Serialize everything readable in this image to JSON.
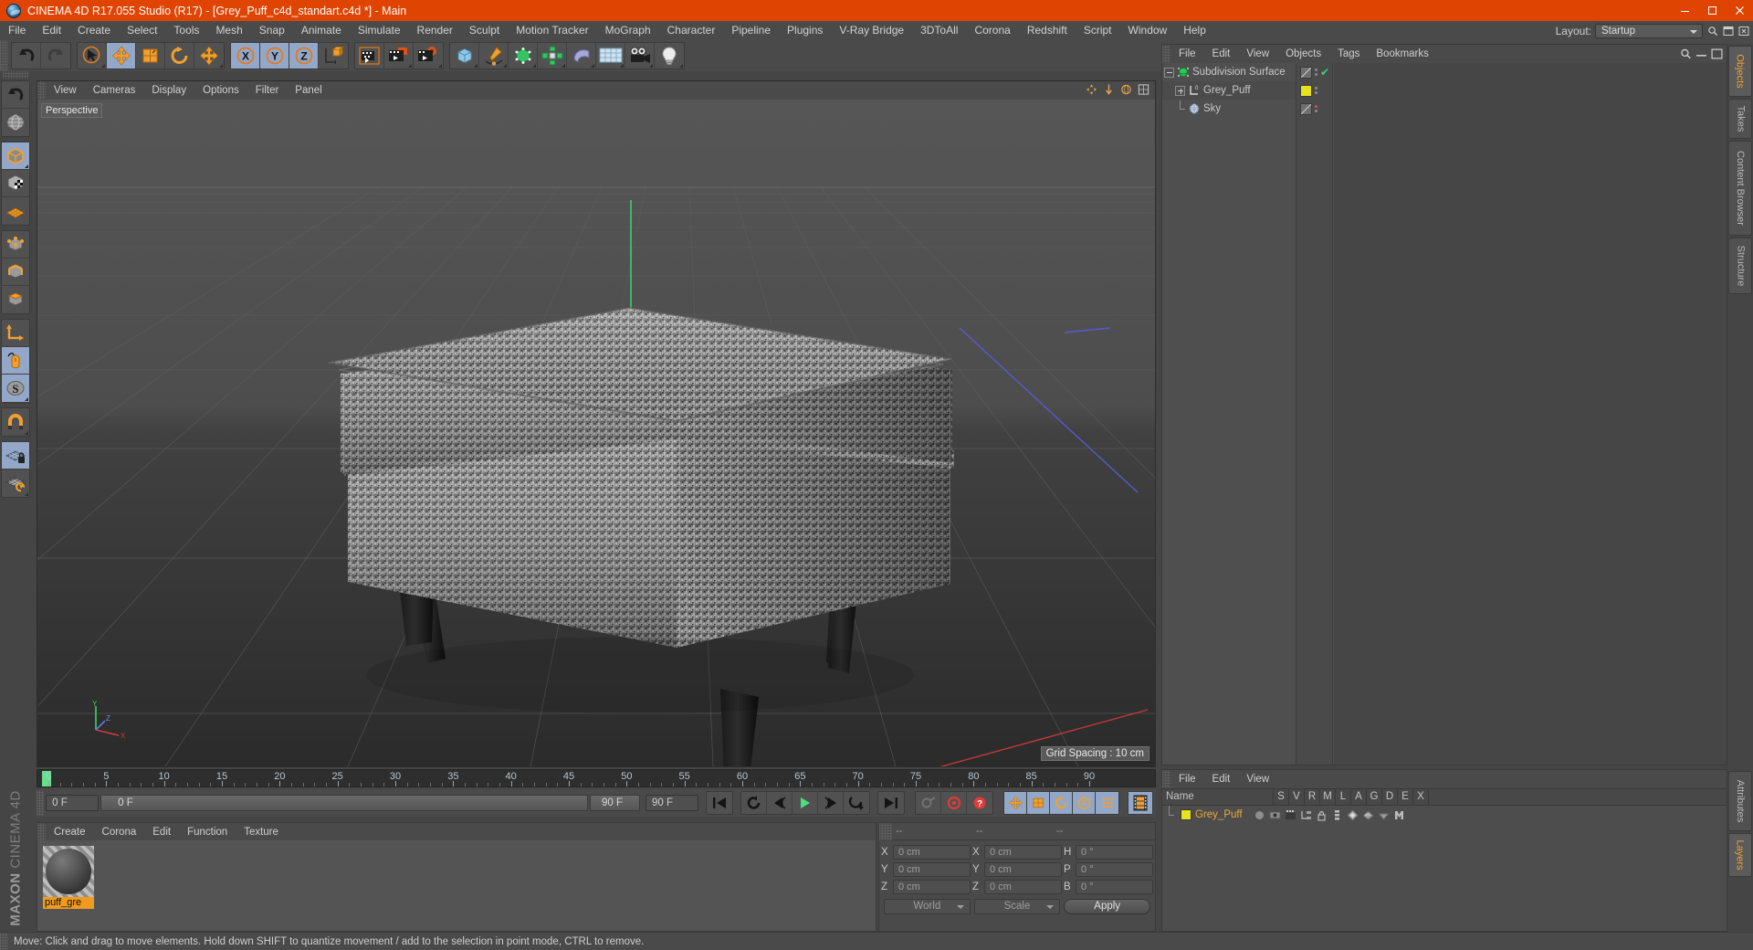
{
  "window": {
    "title": "CINEMA 4D R17.055 Studio (R17) - [Grey_Puff_c4d_standart.c4d *] - Main",
    "logo_icon": "c4d-logo-icon",
    "minimize_label": "Minimize",
    "maximize_label": "Maximize",
    "close_label": "Close",
    "titlebar_color": "#e04403"
  },
  "menubar": {
    "items": [
      "File",
      "Edit",
      "Create",
      "Select",
      "Tools",
      "Mesh",
      "Snap",
      "Animate",
      "Simulate",
      "Render",
      "Sculpt",
      "Motion Tracker",
      "MoGraph",
      "Character",
      "Pipeline",
      "Plugins",
      "V-Ray Bridge",
      "3DToAll",
      "Corona",
      "Redshift",
      "Script",
      "Window",
      "Help"
    ],
    "layout_label": "Layout:",
    "layout_value": "Startup",
    "search_icon": "magnifier-icon",
    "panel_icon": "panel-icon"
  },
  "toolbar_top": {
    "groups": [
      {
        "name": "history",
        "buttons": [
          {
            "name": "undo-button",
            "icon": "undo-arrow-icon",
            "active": false
          },
          {
            "name": "redo-button",
            "icon": "redo-arrow-icon",
            "active": false,
            "disabled": true
          }
        ]
      },
      {
        "name": "transform-tools",
        "buttons": [
          {
            "name": "live-selection-tool",
            "icon": "cursor-circle-icon",
            "active": false
          },
          {
            "name": "move-tool",
            "icon": "move-arrows-icon",
            "active": true
          },
          {
            "name": "scale-tool",
            "icon": "scale-box-icon",
            "active": false
          },
          {
            "name": "rotate-tool",
            "icon": "rotate-arrow-icon",
            "active": false
          },
          {
            "name": "transform-tool",
            "icon": "move-arrows-icon",
            "active": false
          }
        ]
      },
      {
        "name": "axis-locks",
        "buttons": [
          {
            "name": "lock-x-axis",
            "icon": "x-axis-icon",
            "active": true
          },
          {
            "name": "lock-y-axis",
            "icon": "y-axis-icon",
            "active": true
          },
          {
            "name": "lock-z-axis",
            "icon": "z-axis-icon",
            "active": true
          },
          {
            "name": "world-object-coordinate-toggle",
            "icon": "world-axis-cube-icon",
            "active": false
          }
        ]
      },
      {
        "name": "render-group",
        "buttons": [
          {
            "name": "render-view-button",
            "icon": "clapperboard-icon",
            "active": false
          },
          {
            "name": "render-to-picture-viewer-button",
            "icon": "clapperboard-window-icon",
            "active": false
          },
          {
            "name": "render-settings-button",
            "icon": "clapperboard-gear-icon",
            "active": false
          }
        ]
      },
      {
        "name": "create-group",
        "buttons": [
          {
            "name": "add-cube-button",
            "icon": "cube-icon",
            "active": false
          },
          {
            "name": "add-spline-button",
            "icon": "pen-spline-icon",
            "active": false
          },
          {
            "name": "add-nurbs-button",
            "icon": "green-cube-icon",
            "active": false
          },
          {
            "name": "add-mograph-button",
            "icon": "cloner-icon",
            "active": false
          },
          {
            "name": "add-deformer-button",
            "icon": "bend-deformer-icon",
            "active": false
          },
          {
            "name": "add-scene-object-button",
            "icon": "floor-grid-icon",
            "active": false
          },
          {
            "name": "add-camera-button",
            "icon": "camera-icon",
            "active": false
          },
          {
            "name": "add-light-button",
            "icon": "light-bulb-icon",
            "active": false
          }
        ]
      }
    ]
  },
  "toolbar_left": {
    "groups": [
      {
        "name": "undo-group",
        "buttons": [
          {
            "name": "undo-view-button",
            "icon": "undo-arrow-icon",
            "active": false
          },
          {
            "name": "frame-scene-button",
            "icon": "globe-frame-icon",
            "active": false
          }
        ]
      },
      {
        "name": "selection-mode-group",
        "buttons": [
          {
            "name": "make-editable-button",
            "icon": "editable-cube-icon",
            "active": true
          },
          {
            "name": "model-mode-button",
            "icon": "checker-cube-icon",
            "active": false
          },
          {
            "name": "texture-mode-button",
            "icon": "texture-grid-icon",
            "active": false
          }
        ]
      },
      {
        "name": "component-mode-group",
        "buttons": [
          {
            "name": "points-mode-button",
            "icon": "points-cube-icon",
            "active": false
          },
          {
            "name": "edges-mode-button",
            "icon": "edges-cube-icon",
            "active": false
          },
          {
            "name": "polygons-mode-button",
            "icon": "polygons-cube-icon",
            "active": false
          }
        ]
      },
      {
        "name": "axis-group",
        "buttons": [
          {
            "name": "enable-axis-button",
            "icon": "axis-corner-icon",
            "active": false
          },
          {
            "name": "viewport-solo-button",
            "icon": "mouse-icon",
            "active": true
          },
          {
            "name": "soft-selection-button",
            "icon": "s-sphere-icon",
            "active": true
          }
        ]
      },
      {
        "name": "snap-group",
        "buttons": [
          {
            "name": "enable-snapping-button",
            "icon": "magnet-icon",
            "active": false
          }
        ]
      },
      {
        "name": "workplane-group",
        "buttons": [
          {
            "name": "lock-workplane-button",
            "icon": "grid-lock-icon",
            "active": true
          },
          {
            "name": "planar-workplane-button",
            "icon": "grid-rotate-icon",
            "active": false
          }
        ]
      }
    ],
    "brand": "MAXON",
    "brand_sub": "CINEMA 4D"
  },
  "viewport": {
    "menus": [
      "View",
      "Cameras",
      "Display",
      "Options",
      "Filter",
      "Panel"
    ],
    "label": "Perspective",
    "grid_spacing": "Grid Spacing : 10 cm",
    "axis_labels": {
      "x": "X",
      "y": "Y",
      "z": "Z"
    },
    "header_icons": [
      "pan-icon",
      "zoom-icon",
      "orbit-icon",
      "maximize-view-icon"
    ],
    "model_name": "Grey_Puff"
  },
  "timeline": {
    "tick_labels": [
      0,
      5,
      10,
      15,
      20,
      25,
      30,
      35,
      40,
      45,
      50,
      55,
      60,
      65,
      70,
      75,
      80,
      85,
      90
    ],
    "range_start": 0,
    "range_end": 90,
    "current_frame_field": "0 F",
    "current_frame_play": "0 F",
    "end_frame_marker": "90 F",
    "end_frame_field": "90 F",
    "transport": [
      {
        "name": "go-to-start-button",
        "icon": "skip-start-icon"
      },
      {
        "name": "play-backwards-button",
        "icon": "rewind-loop-icon"
      },
      {
        "name": "previous-frame-button",
        "icon": "step-back-icon"
      },
      {
        "name": "play-button",
        "icon": "play-icon"
      },
      {
        "name": "next-frame-button",
        "icon": "step-forward-icon"
      },
      {
        "name": "play-forward-loop-button",
        "icon": "forward-loop-icon"
      },
      {
        "name": "go-to-end-button",
        "icon": "skip-end-icon"
      }
    ],
    "record_group": [
      {
        "name": "record-active-objects-button",
        "icon": "key-icon"
      },
      {
        "name": "autokeying-button",
        "icon": "record-circle-icon"
      },
      {
        "name": "keyframe-selection-button",
        "icon": "question-circle-icon"
      }
    ],
    "keyframe_group": [
      {
        "name": "record-position-button",
        "icon": "move-arrows-icon",
        "active": true
      },
      {
        "name": "record-scale-button",
        "icon": "scale-box-icon",
        "active": true
      },
      {
        "name": "record-rotation-button",
        "icon": "rotate-arrow-icon",
        "active": true
      },
      {
        "name": "record-param-button",
        "icon": "p-circle-icon",
        "active": true
      },
      {
        "name": "record-pla-button",
        "icon": "point-level-icon",
        "active": true
      }
    ],
    "extra_group": [
      {
        "name": "animation-filmstrip-button",
        "icon": "filmstrip-icon",
        "active": true
      }
    ]
  },
  "material_manager": {
    "menus": [
      "Create",
      "Corona",
      "Edit",
      "Function",
      "Texture"
    ],
    "materials": [
      {
        "name": "puff_grey",
        "label": "puff_gre"
      }
    ]
  },
  "coordinates": {
    "headers": [
      "--",
      "--",
      "--"
    ],
    "rows": [
      {
        "pos_label": "X",
        "pos_value": "0 cm",
        "size_label": "X",
        "size_value": "0 cm",
        "rot_label": "H",
        "rot_value": "0 °"
      },
      {
        "pos_label": "Y",
        "pos_value": "0 cm",
        "size_label": "Y",
        "size_value": "0 cm",
        "rot_label": "P",
        "rot_value": "0 °"
      },
      {
        "pos_label": "Z",
        "pos_value": "0 cm",
        "size_label": "Z",
        "size_value": "0 cm",
        "rot_label": "B",
        "rot_value": "0 °"
      }
    ],
    "coord_system": "World",
    "transform_mode": "Scale",
    "apply_label": "Apply"
  },
  "object_manager": {
    "menus": [
      "File",
      "Edit",
      "View",
      "Objects",
      "Tags",
      "Bookmarks"
    ],
    "objects": [
      {
        "name": "Subdivision Surface",
        "icon": "subdivision-surface-icon",
        "indent": 0,
        "expander": "minus",
        "tag": "diag",
        "dot_color": "grey",
        "check": true
      },
      {
        "name": "Grey_Puff",
        "icon": "null-object-icon",
        "indent": 1,
        "expander": "plus",
        "tag": "yellow",
        "dot_color": "grey",
        "check": false
      },
      {
        "name": "Sky",
        "icon": "sky-object-icon",
        "indent": 1,
        "expander": "none",
        "tag": "diag",
        "dot_color": "red",
        "check": false
      }
    ]
  },
  "layers_manager": {
    "menus": [
      "File",
      "Edit",
      "View"
    ],
    "columns": [
      "Name",
      "S",
      "V",
      "R",
      "M",
      "L",
      "A",
      "G",
      "D",
      "E",
      "X"
    ],
    "rows": [
      {
        "name": "Grey_Puff",
        "swatch_color": "#e8e21a",
        "icons": [
          "solo-circle-icon",
          "visible-icon",
          "render-icon",
          "manager-icon",
          "lock-icon",
          "animation-icon",
          "generator-icon",
          "deformer-icon",
          "expression-icon",
          "xref-icon"
        ]
      }
    ]
  },
  "side_tabs": {
    "top": [
      {
        "label": "Objects",
        "active": true
      },
      {
        "label": "Takes",
        "active": false
      },
      {
        "label": "Content Browser",
        "active": false
      },
      {
        "label": "Structure",
        "active": false
      }
    ],
    "bottom": [
      {
        "label": "Attributes",
        "active": false
      },
      {
        "label": "Layers",
        "active": true
      }
    ]
  },
  "statusbar": {
    "text": "Move: Click and drag to move elements. Hold down SHIFT to quantize movement / add to the selection in point mode, CTRL to remove."
  }
}
